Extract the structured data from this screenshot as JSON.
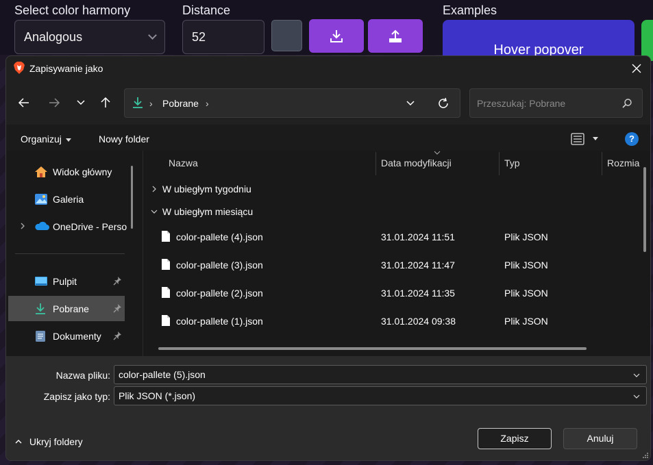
{
  "background_app": {
    "color_harmony_label": "Select color harmony",
    "color_harmony_value": "Analogous",
    "distance_label": "Distance",
    "distance_value": "52",
    "examples_label": "Examples",
    "example_button_text": "Hover popover",
    "accent_color": "#8b3fd9"
  },
  "dialog": {
    "title": "Zapisywanie jako",
    "address": {
      "crumb": "Pobrane",
      "separator": "›"
    },
    "search": {
      "placeholder": "Przeszukaj: Pobrane"
    },
    "toolbar": {
      "organize_label": "Organizuj",
      "new_folder_label": "Nowy folder",
      "help_label": "?"
    },
    "sidebar": {
      "items": [
        {
          "label": "Widok główny",
          "icon": "home-icon"
        },
        {
          "label": "Galeria",
          "icon": "gallery-icon"
        },
        {
          "label": "OneDrive - Perso",
          "icon": "onedrive-icon"
        },
        {
          "label": "Pulpit",
          "icon": "desktop-icon",
          "pinned": true
        },
        {
          "label": "Pobrane",
          "icon": "download-icon",
          "pinned": true,
          "selected": true
        },
        {
          "label": "Dokumenty",
          "icon": "documents-icon",
          "pinned": true
        }
      ]
    },
    "columns": {
      "name": "Nazwa",
      "date": "Data modyfikacji",
      "type": "Typ",
      "size": "Rozmia"
    },
    "groups": [
      {
        "label": "W ubiegłym tygodniu",
        "expanded": false
      },
      {
        "label": "W ubiegłym miesiącu",
        "expanded": true
      }
    ],
    "files": [
      {
        "name": "color-pallete (4).json",
        "date": "31.01.2024 11:51",
        "type": "Plik JSON"
      },
      {
        "name": "color-pallete (3).json",
        "date": "31.01.2024 11:47",
        "type": "Plik JSON"
      },
      {
        "name": "color-pallete (2).json",
        "date": "31.01.2024 11:35",
        "type": "Plik JSON"
      },
      {
        "name": "color-pallete (1).json",
        "date": "31.01.2024 09:38",
        "type": "Plik JSON"
      }
    ],
    "footer": {
      "filename_label": "Nazwa pliku:",
      "filename_value": "color-pallete (5).json",
      "filetype_label": "Zapisz jako typ:",
      "filetype_value": "Plik JSON (*.json)",
      "hide_folders_label": "Ukryj foldery",
      "save_label": "Zapisz",
      "cancel_label": "Anuluj"
    }
  }
}
